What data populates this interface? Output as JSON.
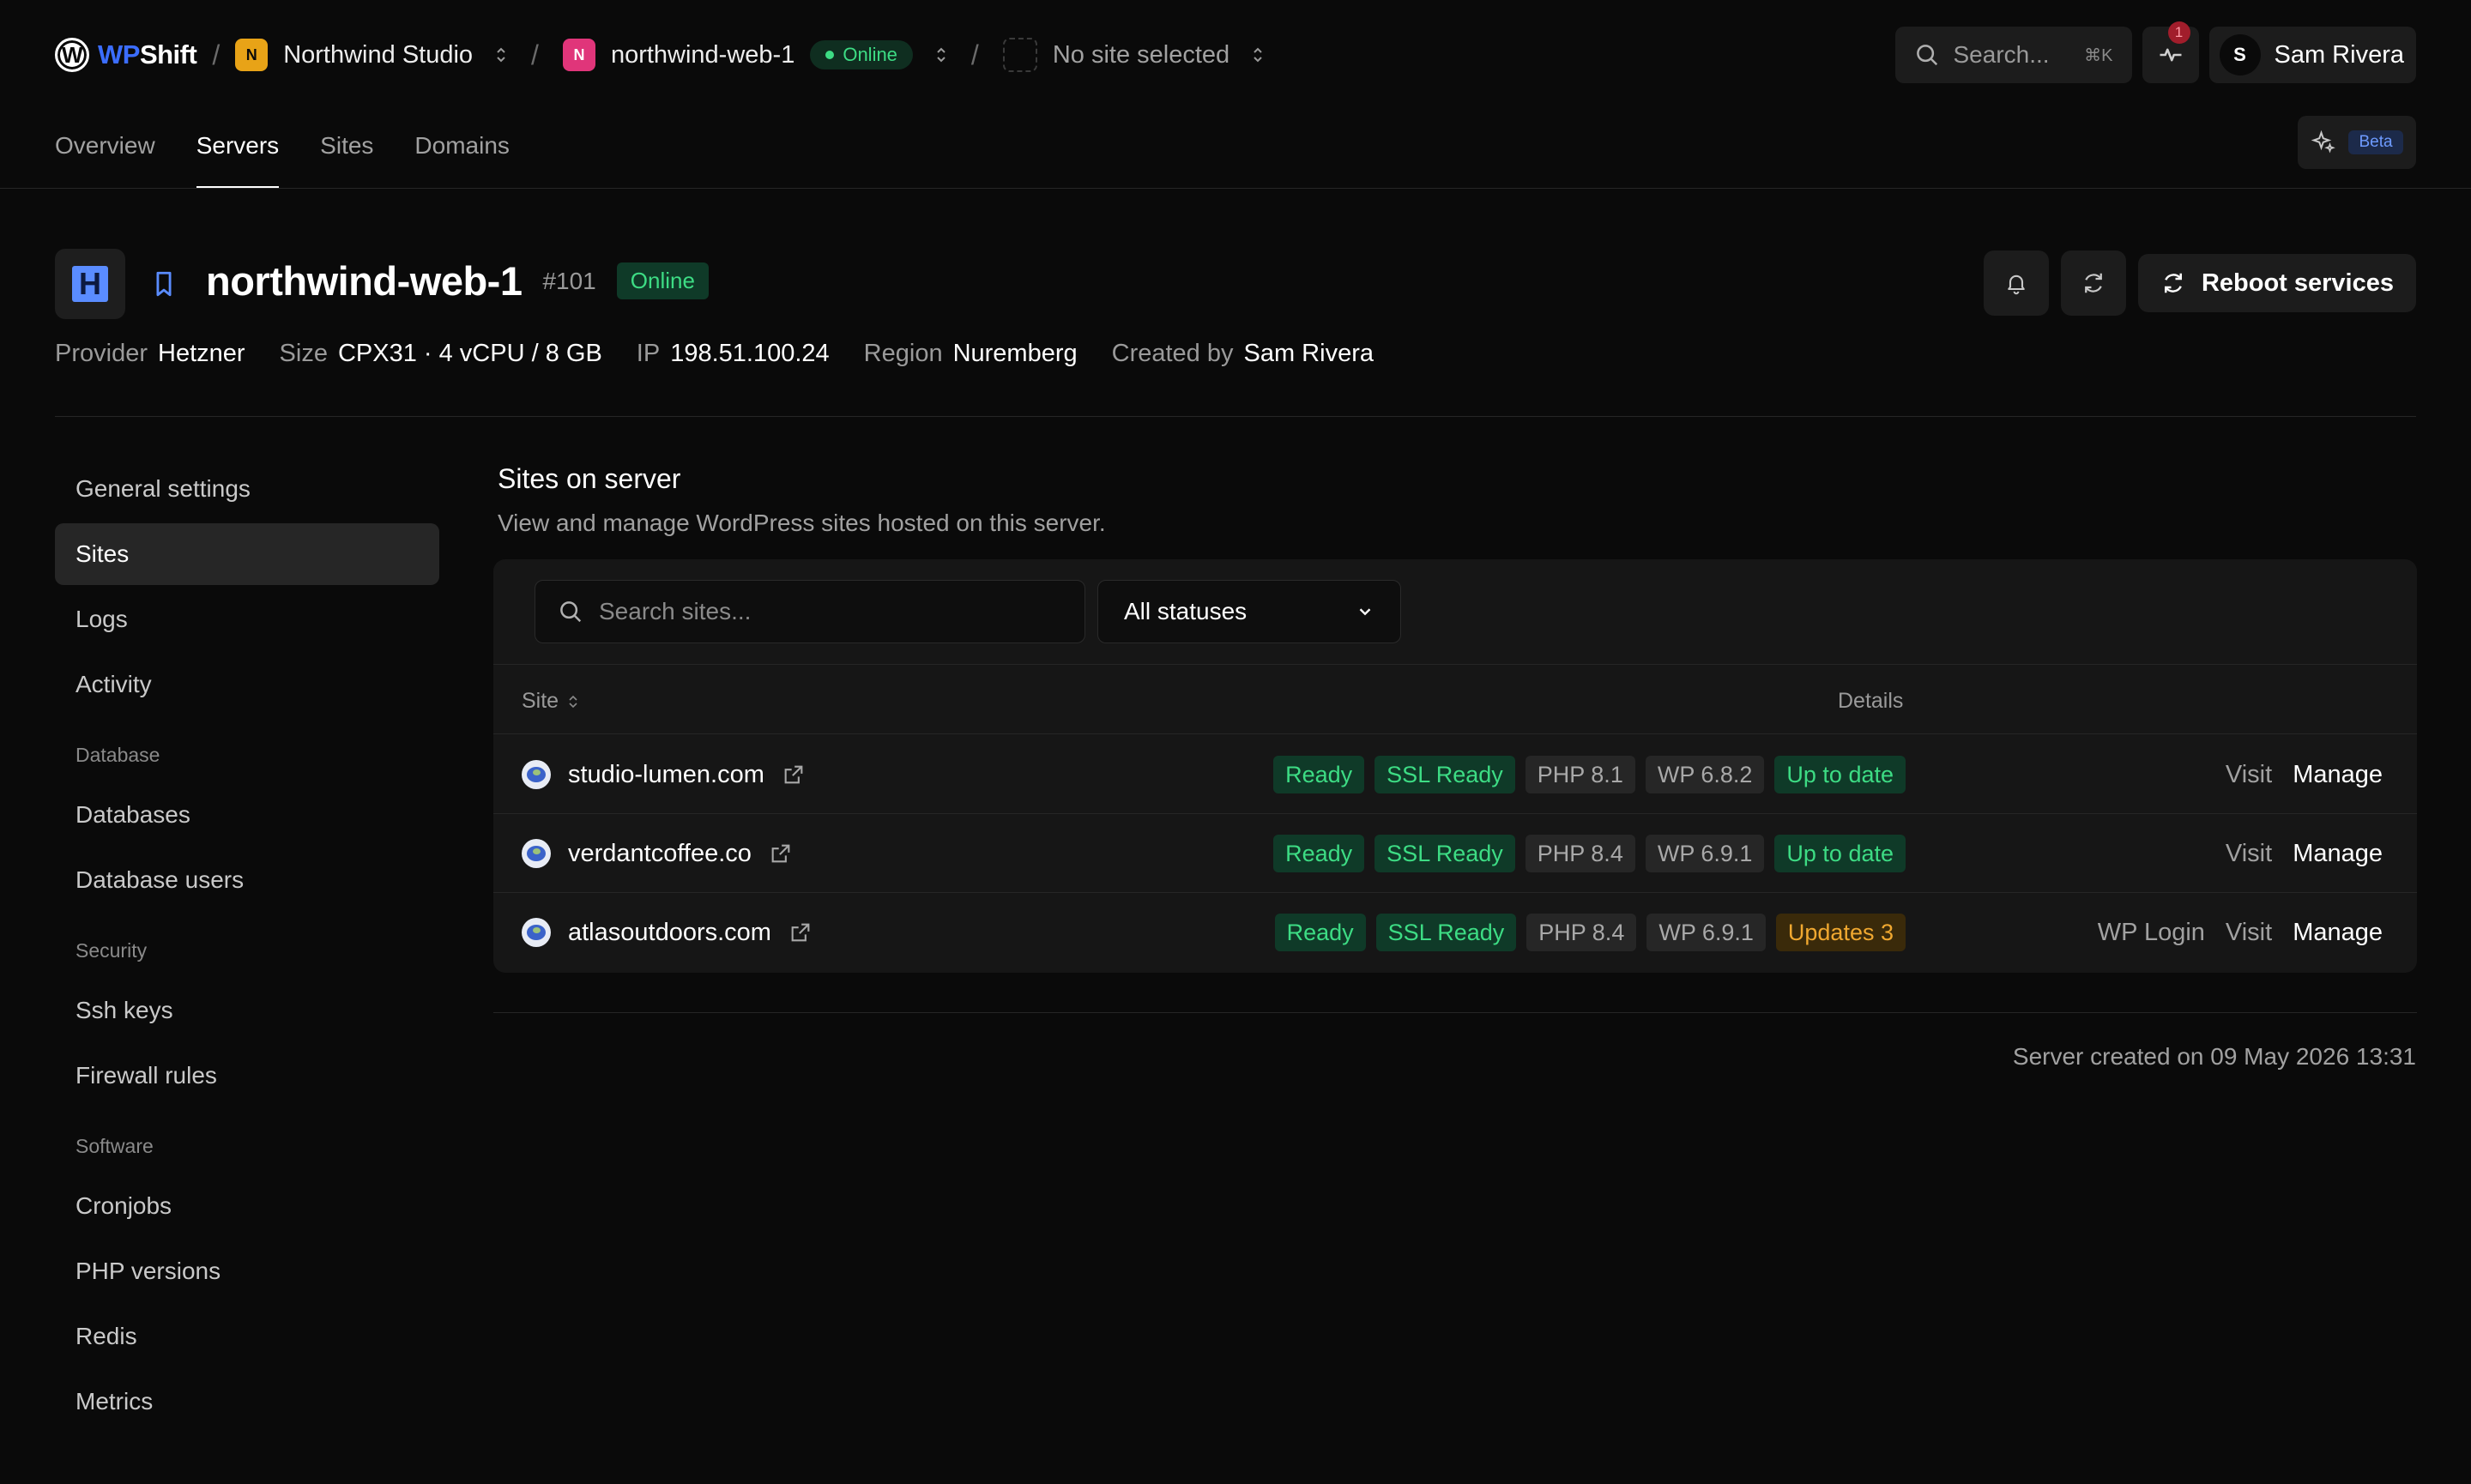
{
  "topbar": {
    "brand_wp": "WP",
    "brand_shift": "Shift",
    "org": {
      "initial": "N",
      "name": "Northwind Studio",
      "color": "#e8a317"
    },
    "server": {
      "initial": "N",
      "name": "northwind-web-1",
      "status": "Online",
      "color": "#e0357a"
    },
    "site_selector": {
      "label": "No site selected"
    },
    "search": {
      "label": "Search...",
      "shortcut": "⌘K"
    },
    "activity_badge": "1",
    "user": {
      "initial": "S",
      "name": "Sam Rivera"
    }
  },
  "tabs": [
    {
      "label": "Overview",
      "active": false
    },
    {
      "label": "Servers",
      "active": true
    },
    {
      "label": "Sites",
      "active": false
    },
    {
      "label": "Domains",
      "active": false
    }
  ],
  "beta_label": "Beta",
  "server": {
    "name": "northwind-web-1",
    "id": "#101",
    "status": "Online",
    "provider_icon_letter": "H",
    "meta": [
      {
        "key": "Provider",
        "value": "Hetzner"
      },
      {
        "key": "Size",
        "value": "CPX31 · 4 vCPU / 8 GB"
      },
      {
        "key": "IP",
        "value": "198.51.100.24"
      },
      {
        "key": "Region",
        "value": "Nuremberg"
      },
      {
        "key": "Created by",
        "value": "Sam Rivera"
      }
    ],
    "reboot_label": "Reboot services"
  },
  "sidebar": {
    "items_top": [
      {
        "label": "General settings",
        "active": false
      },
      {
        "label": "Sites",
        "active": true
      },
      {
        "label": "Logs",
        "active": false
      },
      {
        "label": "Activity",
        "active": false
      }
    ],
    "sections": [
      {
        "title": "Database",
        "items": [
          "Databases",
          "Database users"
        ]
      },
      {
        "title": "Security",
        "items": [
          "Ssh keys",
          "Firewall rules"
        ]
      },
      {
        "title": "Software",
        "items": [
          "Cronjobs",
          "PHP versions",
          "Redis",
          "Metrics"
        ]
      }
    ]
  },
  "main": {
    "title": "Sites on server",
    "description": "View and manage WordPress sites hosted on this server.",
    "search_placeholder": "Search sites...",
    "status_filter": "All statuses",
    "columns": {
      "site": "Site",
      "details": "Details"
    },
    "rows": [
      {
        "domain": "studio-lumen.com",
        "status": "Ready",
        "ssl": "SSL Ready",
        "php": "PHP 8.1",
        "wp": "WP 6.8.2",
        "update": "Up to date",
        "update_kind": "green",
        "actions": [
          "Visit",
          "Manage"
        ]
      },
      {
        "domain": "verdantcoffee.co",
        "status": "Ready",
        "ssl": "SSL Ready",
        "php": "PHP 8.4",
        "wp": "WP 6.9.1",
        "update": "Up to date",
        "update_kind": "green",
        "actions": [
          "Visit",
          "Manage"
        ]
      },
      {
        "domain": "atlasoutdoors.com",
        "status": "Ready",
        "ssl": "SSL Ready",
        "php": "PHP 8.4",
        "wp": "WP 6.9.1",
        "update": "Updates 3",
        "update_kind": "amber",
        "actions": [
          "WP Login",
          "Visit",
          "Manage"
        ]
      }
    ],
    "footer": "Server created on 09 May 2026 13:31"
  }
}
